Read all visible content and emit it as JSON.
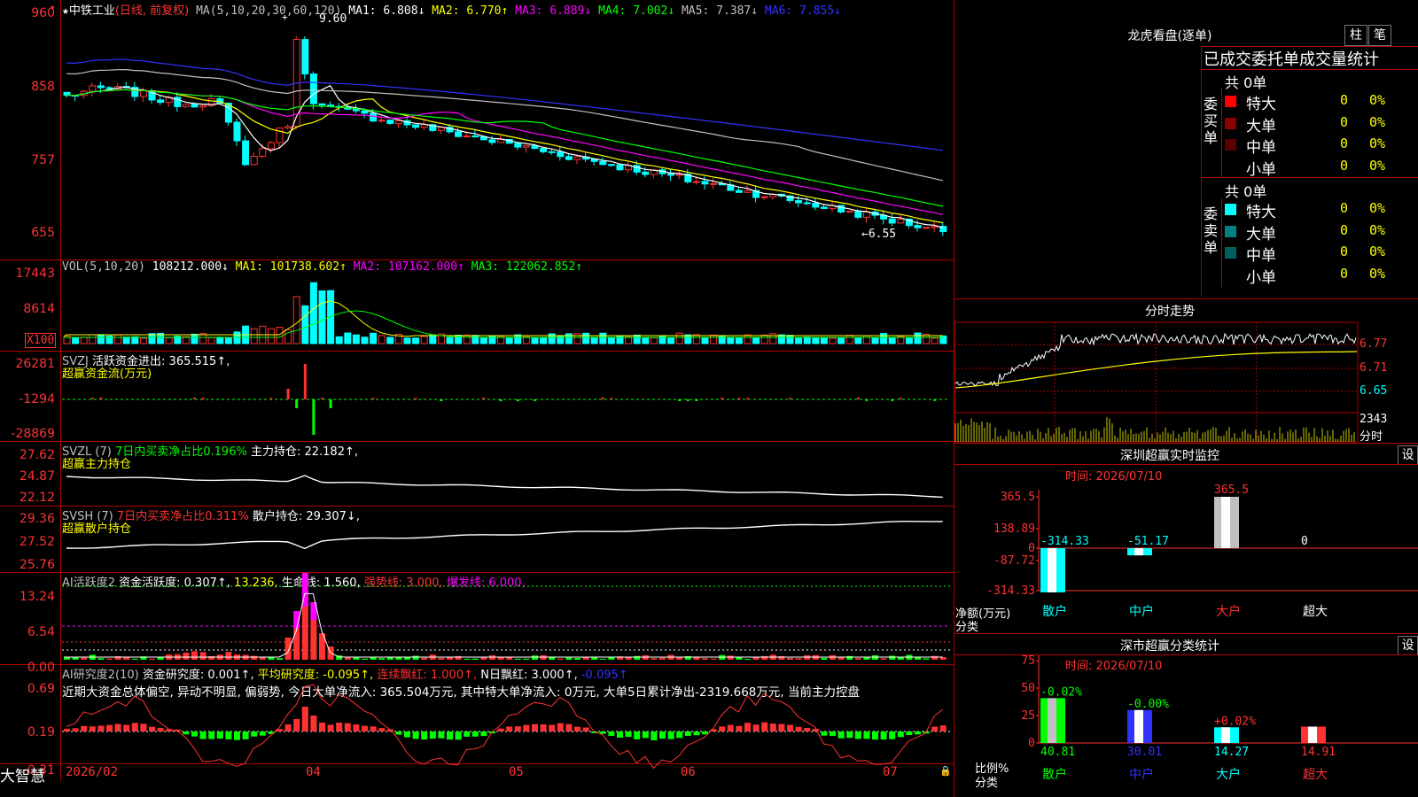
{
  "app": {
    "brand": "大智慧"
  },
  "kline": {
    "title": "中铁工业",
    "period": "(日线, 前复权)",
    "ma_label": "MA(5,10,20,30,60,120)",
    "ma1": "MA1: 6.808↓",
    "ma2": "MA2: 6.770↑",
    "ma3": "MA3: 6.889↓",
    "ma4": "MA4: 7.002↓",
    "ma5": "MA5: 7.387↓",
    "ma6": "MA6: 7.855↓",
    "high_note": "9.60",
    "low_note": "←6.55",
    "y_labels": [
      "960",
      "858",
      "757",
      "655"
    ]
  },
  "vol": {
    "label": "VOL(5,10,20)",
    "value": "108212.000↓",
    "ma1": "MA1: 101738.602↑",
    "ma2": "MA2: 107162.000↑",
    "ma3": "MA3: 122062.852↑",
    "y_labels": [
      "17443",
      "8614",
      "X100"
    ]
  },
  "svzj": {
    "label": "SVZJ",
    "name": "活跃资金进出: 365.515↑,",
    "sub": "超赢资金流(万元)",
    "y_labels": [
      "26281",
      "-1294",
      "-28869"
    ]
  },
  "svzl": {
    "label": "SVZL (7)",
    "ratio": "7日内买卖净占比0.196%",
    "hold": "主力持仓: 22.182↑,",
    "sub": "超赢主力持仓",
    "y_labels": [
      "27.62",
      "24.87",
      "22.12"
    ]
  },
  "svsh": {
    "label": "SVSH (7)",
    "ratio": "7日内买卖净占比0.311%",
    "hold": "散户持仓: 29.307↓,",
    "sub": "超赢散户持仓",
    "y_labels": [
      "29.36",
      "27.52",
      "25.76"
    ]
  },
  "ai_active": {
    "label": "AI活跃度2",
    "v1": "资金活跃度: 0.307↑,",
    "v2": "13.236,",
    "v3": "生命线: 1.560,",
    "v4": "强势线: 3.000,",
    "v5": "爆发线: 6.000,",
    "y_labels": [
      "13.24",
      "6.54",
      "0.00"
    ]
  },
  "ai_research": {
    "label": "AI研究度2(10)",
    "v1": "资金研究度: 0.001↑,",
    "v2": "平均研究度: -0.095↑,",
    "v3": "连续飘红: 1.000↑,",
    "v4": "N日飘红: 3.000↑,",
    "v5": "-0.095↑",
    "comment": "近期大资金总体偏空, 异动不明显, 偏弱势, 今日大单净流入: 365.504万元, 其中特大单净流入: 0万元, 大单5日累计净出-2319.668万元, 当前主力控盘",
    "y_labels": [
      "0.69",
      "0.19",
      "-0.31"
    ]
  },
  "x_axis": [
    "2026/02",
    "04",
    "05",
    "06",
    "07"
  ],
  "right": {
    "lhb_title": "龙虎看盘(逐单)",
    "btn_zhu": "柱",
    "btn_bi": "笔",
    "stats_header": "已成交委托单成交量统计",
    "buy": {
      "side": "委买单",
      "total": "共 0单",
      "rows": [
        {
          "name": "特大",
          "val": "0",
          "pct": "0%",
          "color": "#ff0000"
        },
        {
          "name": "大单",
          "val": "0",
          "pct": "0%",
          "color": "#8b0000"
        },
        {
          "name": "中单",
          "val": "0",
          "pct": "0%",
          "color": "#5a0000"
        },
        {
          "name": "小单",
          "val": "0",
          "pct": "0%",
          "color": ""
        }
      ]
    },
    "sell": {
      "side": "委卖单",
      "total": "共 0单",
      "rows": [
        {
          "name": "特大",
          "val": "0",
          "pct": "0%",
          "color": "#00ffff"
        },
        {
          "name": "大单",
          "val": "0",
          "pct": "0%",
          "color": "#008080"
        },
        {
          "name": "中单",
          "val": "0",
          "pct": "0%",
          "color": "#006060"
        },
        {
          "name": "小单",
          "val": "0",
          "pct": "0%",
          "color": ""
        }
      ]
    },
    "timeshare": {
      "title": "分时走势",
      "y_labels": [
        "6.77",
        "6.71",
        "6.65"
      ],
      "vol_label": "2343",
      "vol_unit": "分时"
    },
    "realtime": {
      "title": "深圳超赢实时监控",
      "btn": "设",
      "time": "时间: 2026/07/10",
      "y_labels": [
        "365.5",
        "138.89",
        "0",
        "-87.72",
        "-314.33"
      ],
      "unit": "净额(万元)",
      "cat_label": "分类",
      "values": [
        -314.33,
        -51.17,
        365.5,
        0
      ],
      "value_labels": [
        "-314.33",
        "-51.17",
        "365.5",
        "0"
      ],
      "categories": [
        "散户",
        "中户",
        "大户",
        "超大"
      ]
    },
    "classify": {
      "title": "深市超赢分类统计",
      "btn": "设",
      "time": "时间: 2026/07/10",
      "y_labels": [
        "75",
        "50",
        "25",
        "0"
      ],
      "unit": "比例%",
      "cat_label": "分类",
      "values": [
        40.81,
        30.01,
        14.27,
        14.91
      ],
      "changes": [
        "-0.02%",
        "-0.00%",
        "+0.02%",
        ""
      ],
      "value_labels": [
        "40.81",
        "30.01",
        "14.27",
        "14.91"
      ],
      "categories": [
        "散户",
        "中户",
        "大户",
        "超大"
      ]
    }
  }
}
